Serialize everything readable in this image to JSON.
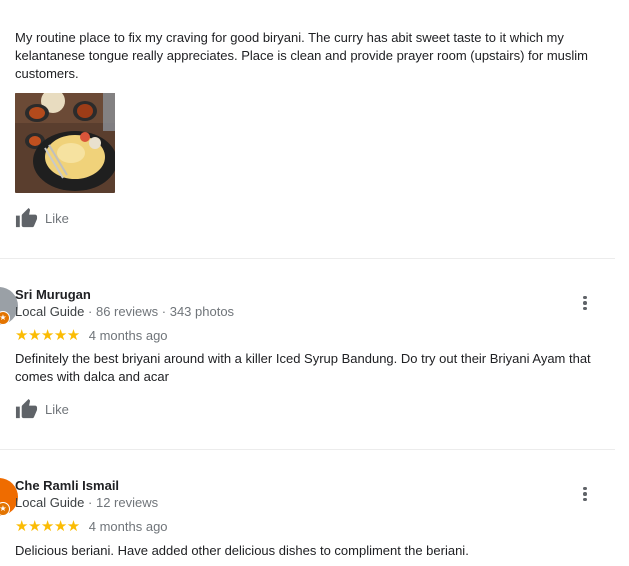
{
  "reviews": [
    {
      "text": "My routine place to fix my craving for good biryani. The curry has abit sweet taste to it which my kelantanese tongue really appreciates. Place is clean and provide prayer room (upstairs) for muslim customers.",
      "like_label": "Like"
    },
    {
      "name": "Sri Murugan",
      "guide_label": "Local Guide",
      "reviews_count": "86 reviews",
      "photos_count": "343 photos",
      "stars": "★★★★★",
      "rating": 5,
      "time": "4 months ago",
      "text": "Definitely the best briyani around with a killer Iced Syrup Bandung. Do try out their Briyani Ayam that comes with dalca and acar",
      "like_label": "Like"
    },
    {
      "name": "Che Ramli Ismail",
      "guide_label": "Local Guide",
      "reviews_count": "12 reviews",
      "stars": "★★★★★",
      "rating": 5,
      "time": "4 months ago",
      "text": "Delicious beriani. Have added other delicious dishes to compliment the beriani."
    }
  ],
  "separator": "·",
  "colors": {
    "star": "#fbbc04",
    "guide_badge": "#e37400",
    "muted_text": "#70757a"
  },
  "icons": {
    "like": "thumbs-up-icon",
    "more": "more-vert-icon",
    "badge": "local-guide-star-icon"
  }
}
